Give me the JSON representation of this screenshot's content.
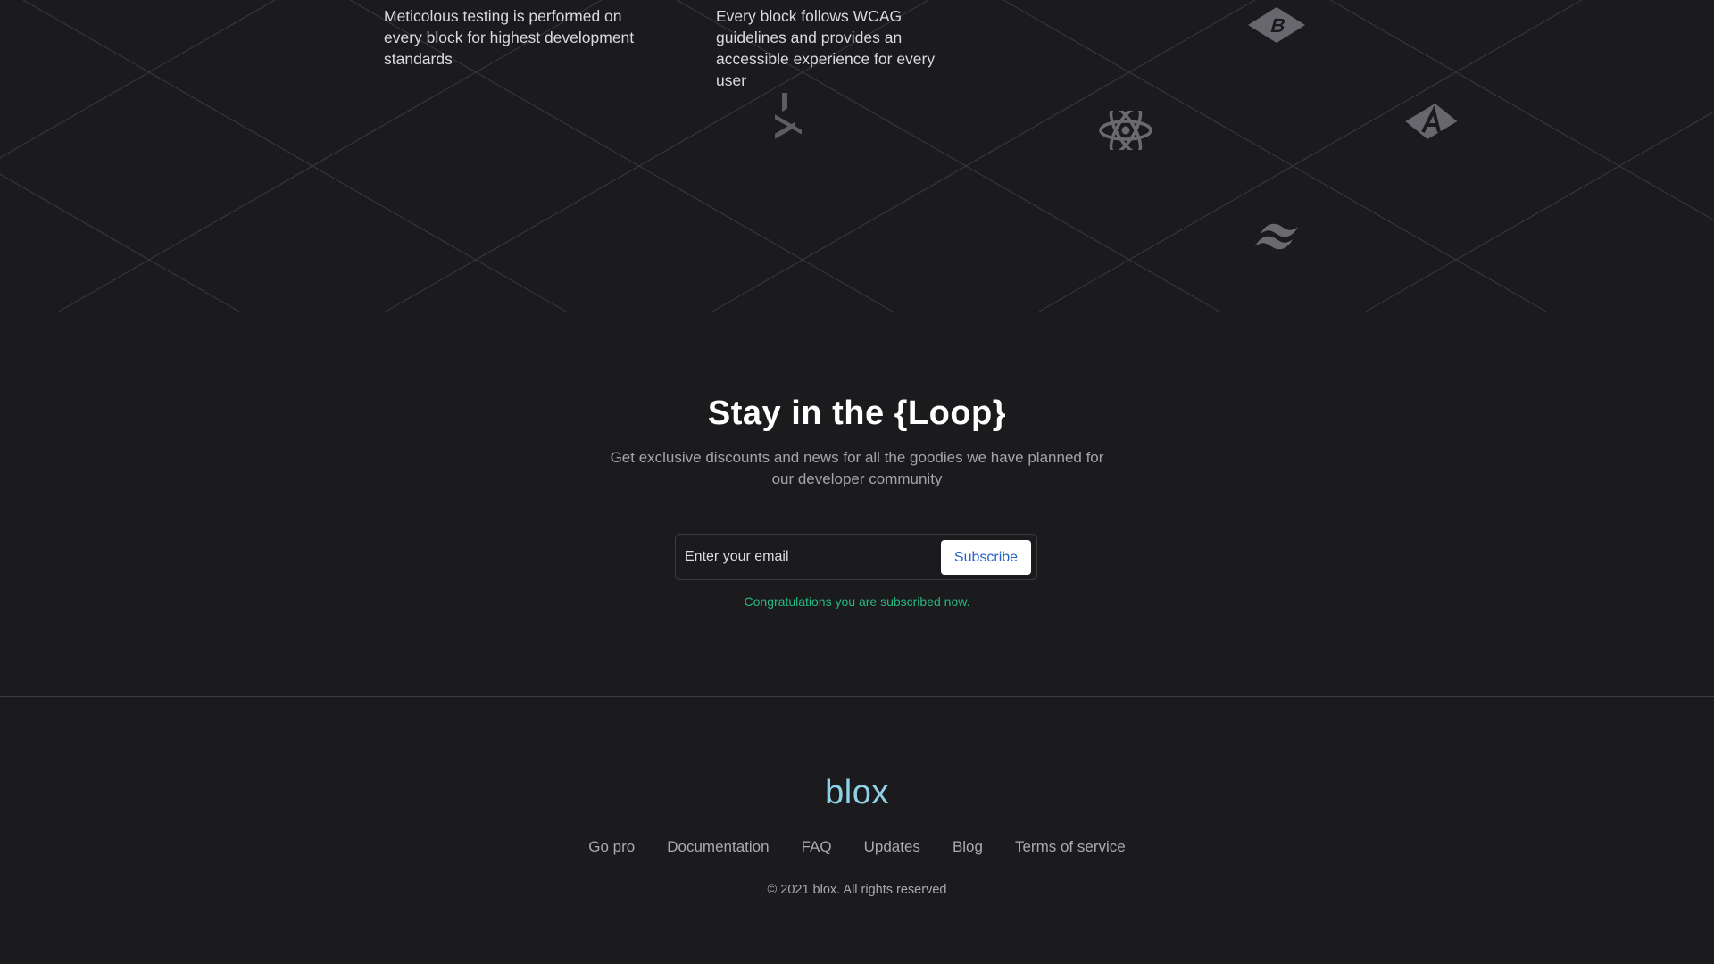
{
  "features": {
    "testing_text": "Meticolous testing is performed on every block for highest development standards",
    "accessibility_text": "Every block follows WCAG guidelines and provides an accessible experience for every user",
    "icons": [
      "bootstrap-icon",
      "prettier-icon",
      "react-icon",
      "angular-icon",
      "tailwind-icon"
    ]
  },
  "newsletter": {
    "title": "Stay in the {Loop}",
    "subtitle": "Get exclusive discounts and news for all the goodies we have planned for our developer community",
    "email_placeholder": "Enter your email",
    "subscribe_label": "Subscribe",
    "success_message": "Congratulations you are subscribed now."
  },
  "footer": {
    "brand": "blox",
    "links": [
      "Go pro",
      "Documentation",
      "FAQ",
      "Updates",
      "Blog",
      "Terms of service"
    ],
    "copyright": "© 2021 blox. All rights reserved"
  },
  "colors": {
    "background": "#1b1b1e",
    "brand": "#8fd0e9",
    "success": "#27b87f",
    "subscribe_text": "#2563c7",
    "divider": "#3c3c42"
  }
}
